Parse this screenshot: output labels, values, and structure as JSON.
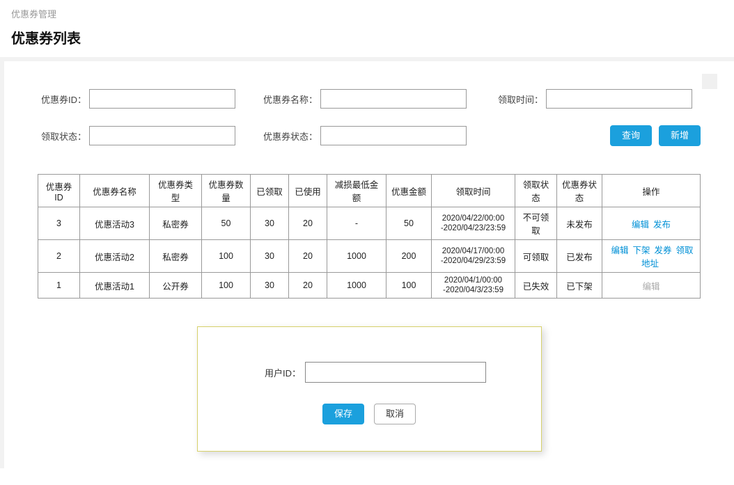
{
  "breadcrumb": "优惠券管理",
  "page_title": "优惠券列表",
  "filters": {
    "coupon_id_label": "优惠券ID：",
    "coupon_id_value": "",
    "coupon_name_label": "优惠券名称：",
    "coupon_name_value": "",
    "claim_time_label": "领取时间：",
    "claim_time_value": "",
    "claim_status_label": "领取状态：",
    "claim_status_value": "",
    "coupon_status_label": "优惠券状态：",
    "coupon_status_value": "",
    "search_btn": "查询",
    "add_btn": "新增"
  },
  "table": {
    "headers": {
      "id": "优惠券ID",
      "name": "优惠券名称",
      "type": "优惠券类型",
      "qty": "优惠券数量",
      "claimed": "已领取",
      "used": "已使用",
      "min_amount": "减损最低金额",
      "coupon_amount": "优惠金额",
      "claim_time": "领取时间",
      "claim_status": "领取状态",
      "coupon_status": "优惠券状态",
      "ops": "操作"
    },
    "rows": [
      {
        "id": "3",
        "name": "优惠活动3",
        "type": "私密券",
        "qty": "50",
        "claimed": "30",
        "used": "20",
        "min_amount": "-",
        "coupon_amount": "50",
        "claim_time_l1": "2020/04/22/00:00",
        "claim_time_l2": "-2020/04/23/23:59",
        "claim_status": "不可领取",
        "coupon_status": "未发布",
        "ops": [
          {
            "label": "编辑",
            "enabled": true
          },
          {
            "label": "发布",
            "enabled": true
          }
        ]
      },
      {
        "id": "2",
        "name": "优惠活动2",
        "type": "私密券",
        "qty": "100",
        "claimed": "30",
        "used": "20",
        "min_amount": "1000",
        "coupon_amount": "200",
        "claim_time_l1": "2020/04/17/00:00",
        "claim_time_l2": "-2020/04/29/23:59",
        "claim_status": "可领取",
        "coupon_status": "已发布",
        "ops": [
          {
            "label": "编辑",
            "enabled": true
          },
          {
            "label": "下架",
            "enabled": true
          },
          {
            "label": "发券",
            "enabled": true
          },
          {
            "label": "领取地址",
            "enabled": true
          }
        ]
      },
      {
        "id": "1",
        "name": "优惠活动1",
        "type": "公开券",
        "qty": "100",
        "claimed": "30",
        "used": "20",
        "min_amount": "1000",
        "coupon_amount": "100",
        "claim_time_l1": "2020/04/1/00:00",
        "claim_time_l2": "-2020/04/3/23:59",
        "claim_status": "已失效",
        "coupon_status": "已下架",
        "ops": [
          {
            "label": "编辑",
            "enabled": false
          }
        ]
      }
    ]
  },
  "modal": {
    "user_id_label": "用户ID：",
    "user_id_value": "",
    "save_btn": "保存",
    "cancel_btn": "取消"
  }
}
